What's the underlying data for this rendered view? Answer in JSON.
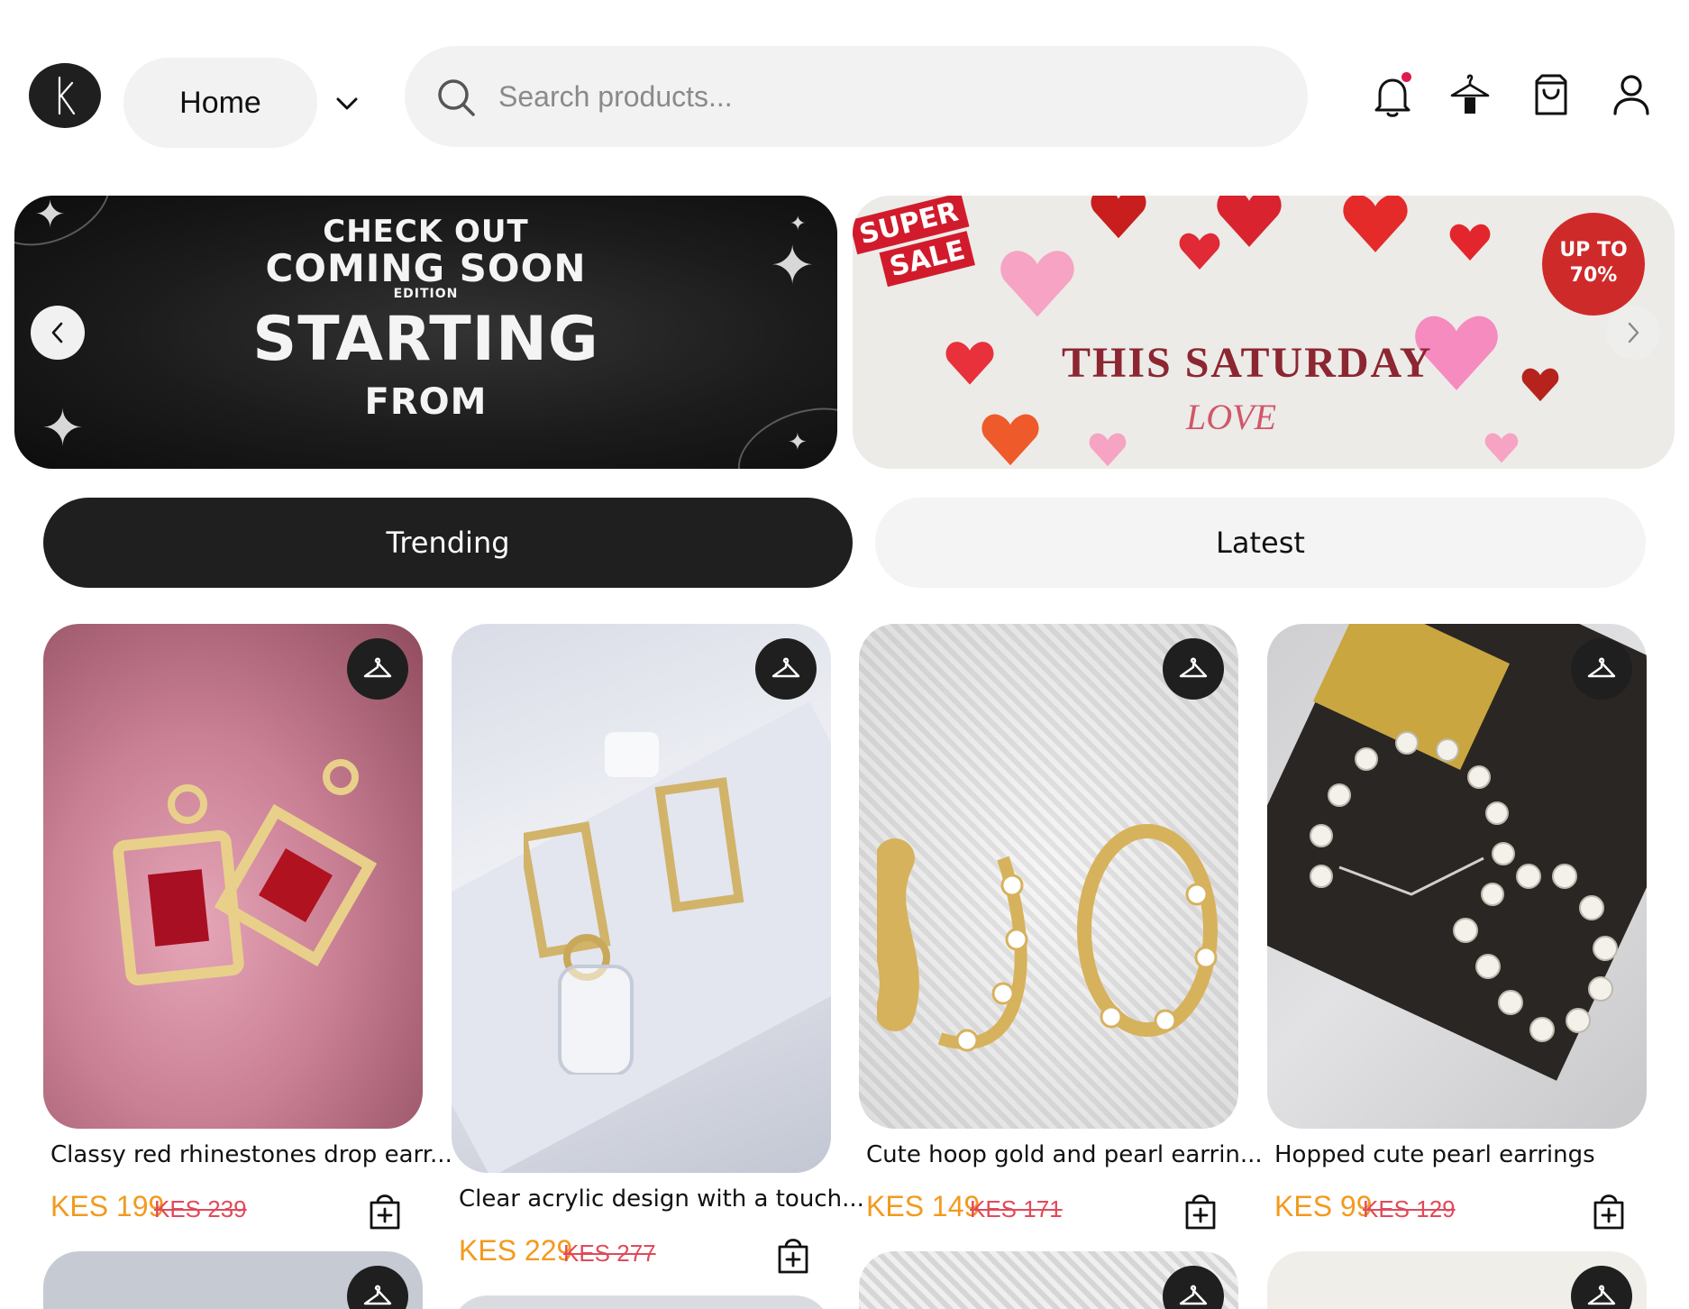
{
  "header": {
    "logo_icon": "k-logo-icon",
    "home_label": "Home",
    "search_placeholder": "Search products...",
    "icons": [
      "bell-icon",
      "hanger-icon",
      "shopping-bag-icon",
      "user-icon"
    ],
    "notification_dot_color": "#e0194c"
  },
  "banners": {
    "left": {
      "line1": "CHECK OUT",
      "line2": "COMING SOON",
      "line3": "EDITION",
      "line4": "STARTING",
      "line5": "FROM"
    },
    "right": {
      "sale_line1": "SUPER",
      "sale_line2": "SALE",
      "badge_line1": "UP TO",
      "badge_line2": "70%",
      "title": "THIS  SATURDAY",
      "subtitle": "LOVE"
    },
    "prev_icon": "chevron-left-icon",
    "next_icon": "chevron-right-icon"
  },
  "tabs": [
    {
      "label": "Trending",
      "active": true
    },
    {
      "label": "Latest",
      "active": false
    }
  ],
  "products": [
    {
      "title": "Classy red rhinestones drop earr...",
      "price": "KES 199",
      "old_price": "KES 239"
    },
    {
      "title": "Clear acrylic design with a touch...",
      "price": "KES 229",
      "old_price": "KES 277"
    },
    {
      "title": "Cute hoop gold and pearl earrin...",
      "price": "KES 149",
      "old_price": "KES 171"
    },
    {
      "title": "Hopped cute pearl earrings",
      "price": "KES 99",
      "old_price": "KES 129"
    }
  ],
  "colors": {
    "accent_price": "#f39a1e",
    "old_price": "#e04a5a",
    "dark": "#1f1f1f"
  }
}
